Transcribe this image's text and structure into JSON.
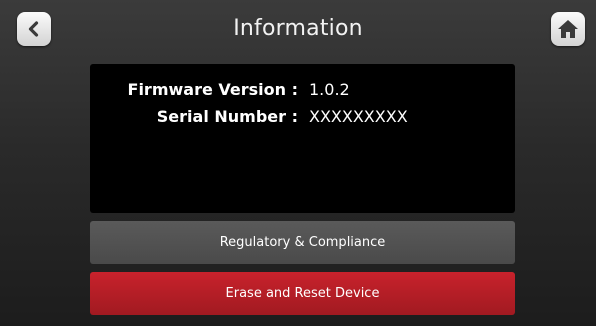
{
  "header": {
    "title": "Information",
    "back_icon": "chevron-left-icon",
    "home_icon": "home-icon"
  },
  "info": {
    "firmware_label": "Firmware Version :",
    "firmware_value": "1.0.2",
    "serial_label": "Serial Number :",
    "serial_value": "XXXXXXXXX"
  },
  "actions": {
    "regulatory_label": "Regulatory & Compliance",
    "erase_label": "Erase and Reset Device"
  },
  "colors": {
    "background_top": "#3b3b3b",
    "background_bottom": "#1c1c1c",
    "panel": "#000000",
    "regulatory_button": "#4f4f4f",
    "erase_button": "#b71e26",
    "nav_button": "#e6e6e6",
    "nav_icon": "#3a3a3a"
  }
}
